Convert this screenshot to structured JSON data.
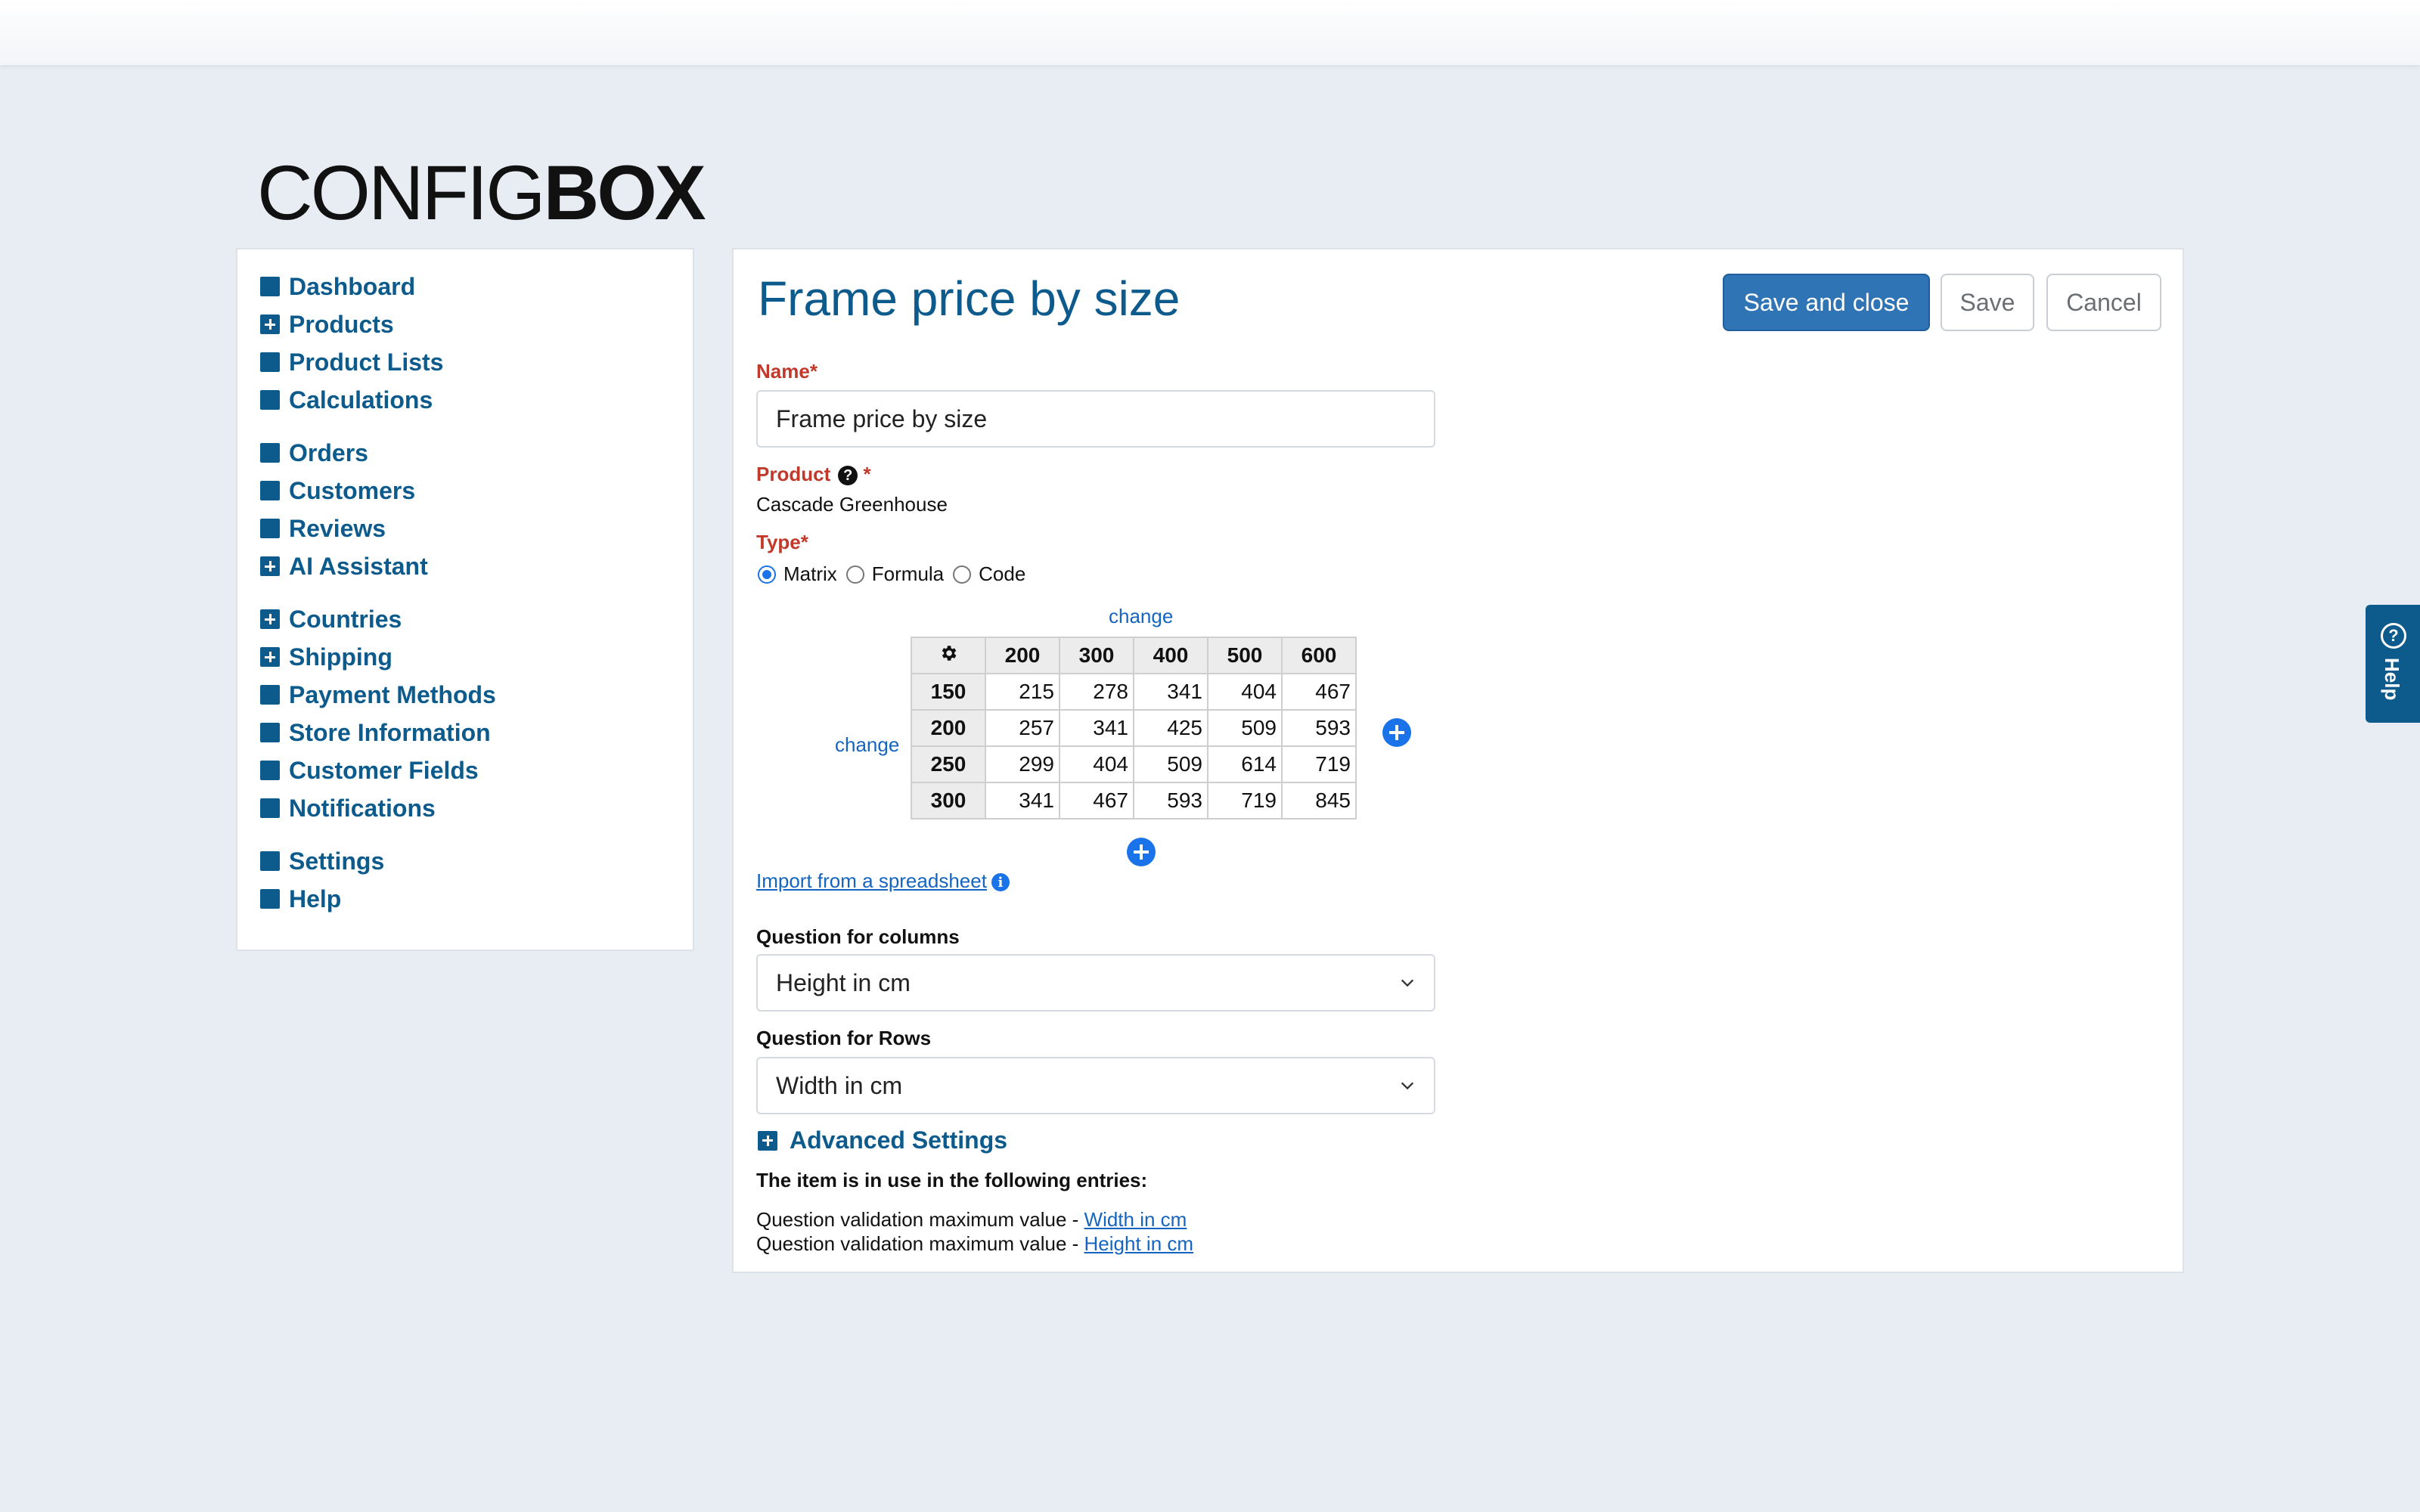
{
  "logo": {
    "thin": "CONFIG",
    "bold": "BOX"
  },
  "sidebar": {
    "groups": [
      [
        {
          "label": "Dashboard",
          "icon": "square-icon"
        },
        {
          "label": "Products",
          "icon": "plus-square-icon"
        },
        {
          "label": "Product Lists",
          "icon": "square-icon"
        },
        {
          "label": "Calculations",
          "icon": "square-icon"
        }
      ],
      [
        {
          "label": "Orders",
          "icon": "square-icon"
        },
        {
          "label": "Customers",
          "icon": "square-icon"
        },
        {
          "label": "Reviews",
          "icon": "square-icon"
        },
        {
          "label": "AI Assistant",
          "icon": "plus-square-icon"
        }
      ],
      [
        {
          "label": "Countries",
          "icon": "plus-square-icon"
        },
        {
          "label": "Shipping",
          "icon": "plus-square-icon"
        },
        {
          "label": "Payment Methods",
          "icon": "square-icon"
        },
        {
          "label": "Store Information",
          "icon": "square-icon"
        },
        {
          "label": "Customer Fields",
          "icon": "square-icon"
        },
        {
          "label": "Notifications",
          "icon": "square-icon"
        }
      ],
      [
        {
          "label": "Settings",
          "icon": "square-icon"
        },
        {
          "label": "Help",
          "icon": "square-icon"
        }
      ]
    ]
  },
  "main": {
    "title": "Frame price by size",
    "buttons": {
      "save_close": "Save and close",
      "save": "Save",
      "cancel": "Cancel"
    },
    "name_label": "Name*",
    "name_value": "Frame price by size",
    "product_label": "Product",
    "product_req": "*",
    "product_value": "Cascade Greenhouse",
    "type_label": "Type*",
    "type_options": [
      "Matrix",
      "Formula",
      "Code"
    ],
    "type_selected": "Matrix",
    "change_label": "change",
    "matrix": {
      "columns": [
        "200",
        "300",
        "400",
        "500",
        "600"
      ],
      "rows": [
        {
          "header": "150",
          "values": [
            "215",
            "278",
            "341",
            "404",
            "467"
          ]
        },
        {
          "header": "200",
          "values": [
            "257",
            "341",
            "425",
            "509",
            "593"
          ]
        },
        {
          "header": "250",
          "values": [
            "299",
            "404",
            "509",
            "614",
            "719"
          ]
        },
        {
          "header": "300",
          "values": [
            "341",
            "467",
            "593",
            "719",
            "845"
          ]
        }
      ]
    },
    "import_link": "Import from a spreadsheet",
    "columns_question_label": "Question for columns",
    "columns_question_value": "Height in cm",
    "rows_question_label": "Question for Rows",
    "rows_question_value": "Width in cm",
    "advanced_label": "Advanced Settings",
    "usage_heading": "The item is in use in the following entries:",
    "usage": [
      {
        "prefix": "Question validation maximum value - ",
        "link": "Width in cm"
      },
      {
        "prefix": "Question validation maximum value - ",
        "link": "Height in cm"
      }
    ]
  },
  "help_tab": {
    "label": "Help"
  },
  "colors": {
    "brand": "#0d5b8c",
    "primary_button": "#2f74b5",
    "required": "#c0392b",
    "link": "#1565c0"
  }
}
